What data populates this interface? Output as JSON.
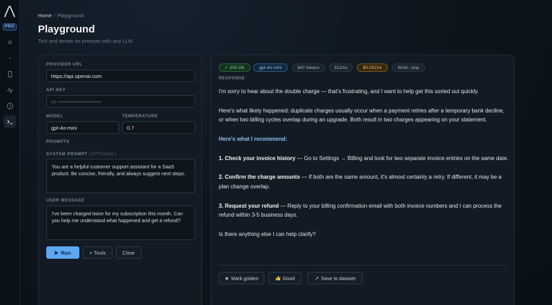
{
  "sidebar": {
    "badge": "PRO",
    "icons": [
      "dot-icon",
      "small-dot-icon",
      "mobile-icon",
      "activity-icon",
      "clock-icon",
      "terminal-icon"
    ]
  },
  "header": {
    "breadcrumb_home": "Home",
    "breadcrumb_sep": "/",
    "breadcrumb_current": "Playground",
    "title": "Playground",
    "subtitle": "Test and iterate on prompts with any LLM"
  },
  "form": {
    "provider_url_label": "PROVIDER URL",
    "provider_url_value": "https://api.openai.com",
    "api_key_label": "API KEY",
    "api_key_value": "sk-••••••••••••••••••••••••",
    "model_label": "MODEL",
    "model_value": "gpt-4o-mini",
    "temperature_label": "TEMPERATURE",
    "temperature_value": "0.7",
    "prompts_label": "PROMPTS",
    "system_prompt_label": "SYSTEM PROMPT",
    "system_prompt_optional": "(OPTIONAL)",
    "system_prompt_value": "You are a helpful customer support assistant for a SaaS product. Be concise, friendly, and always suggest next steps.",
    "user_message_label": "USER MESSAGE",
    "user_message_value": "I've been charged twice for my subscription this month. Can you help me understand what happened and get a refund?",
    "run_label": "Run",
    "tools_label": "+ Tools",
    "clear_label": "Clear"
  },
  "response": {
    "badges": {
      "status": "✓ 200 OK",
      "model": "gpt-4o-mini",
      "tokens": "847 tokens",
      "latency": "312ms",
      "cost": "$0.00214",
      "finish": "finish: stop"
    },
    "label": "RESPONSE",
    "p1": "I'm sorry to hear about the double charge — that's frustrating, and I want to help get this sorted out quickly.",
    "p2": "Here's what likely happened: duplicate charges usually occur when a payment retries after a temporary bank decline, or when two billing cycles overlap during an upgrade. Both result in two charges appearing on your statement.",
    "heading": "Here's what I recommend:",
    "step1_title": "1. Check your invoice history",
    "step1_text": " — Go to Settings → Billing and look for two separate invoice entries on the same date.",
    "step2_title": "2. Confirm the charge amounts",
    "step2_text": " — If both are the same amount, it's almost certainly a retry. If different, it may be a plan change overlap.",
    "step3_title": "3. Request your refund",
    "step3_text": " — Reply to your billing confirmation email with both invoice numbers and I can process the refund within 3-5 business days.",
    "closing": "Is there anything else I can help clarify?",
    "actions": {
      "golden": "Mark golden",
      "good": "Good",
      "dataset": "Save to dataset"
    }
  },
  "colors": {
    "accent": "#5da6f0",
    "ok": "#7fd796",
    "cost": "#f0b85a",
    "background": "#0d141c"
  }
}
